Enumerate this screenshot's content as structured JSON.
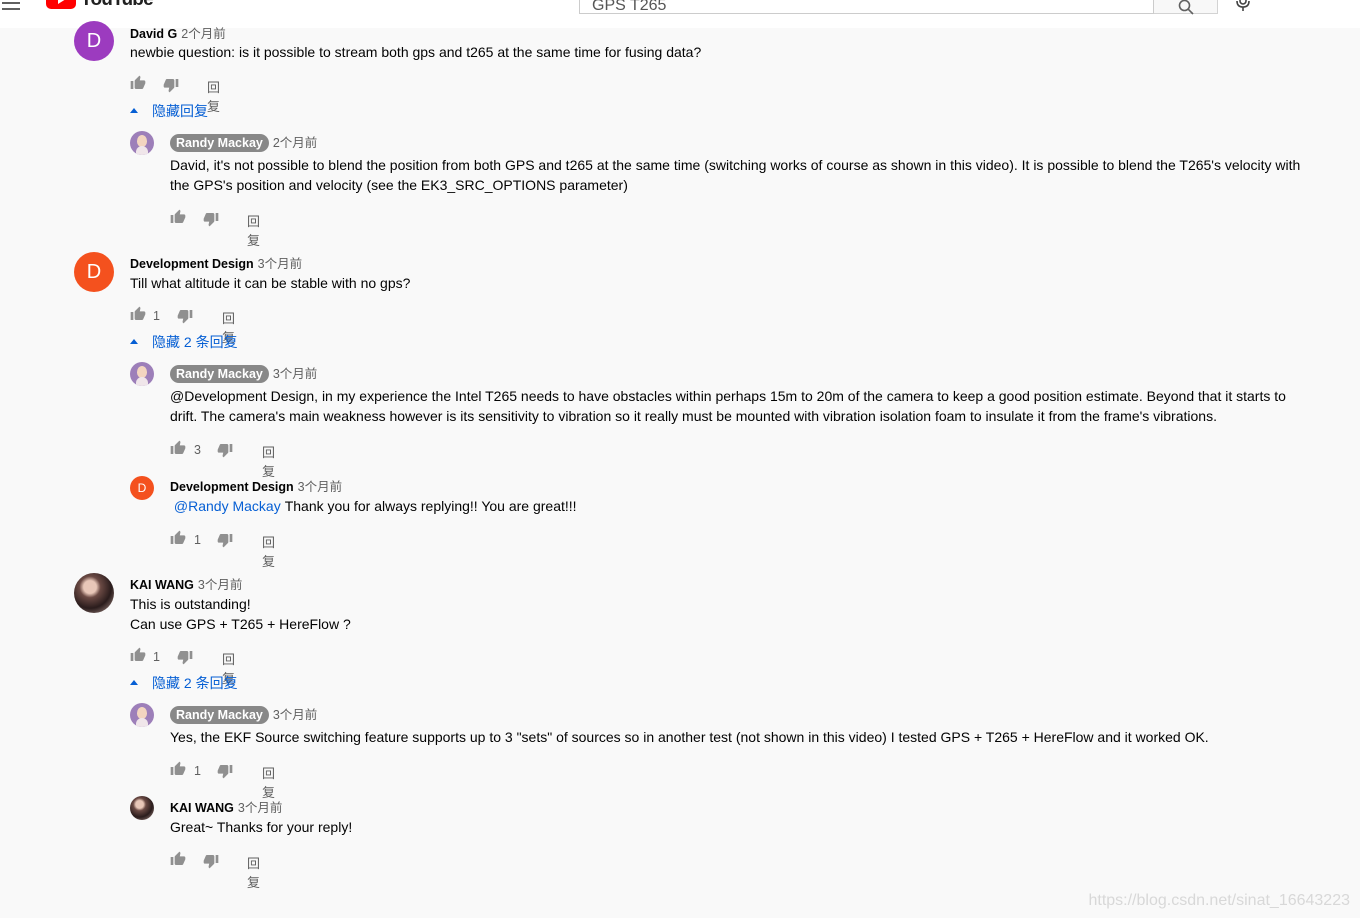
{
  "header": {
    "logo_text": "YouTube",
    "search_value": "GPS T265"
  },
  "threads": [
    {
      "author": "David G",
      "avatar_letter": "D",
      "time": "2个月前",
      "text": [
        "newbie question:  is it possible to stream both gps and t265 at the same time for fusing data?"
      ],
      "likes": "",
      "reply_label": "回复",
      "toggle_label": "隐藏回复",
      "replies": [
        {
          "author": "Randy Mackay",
          "time": "2个月前",
          "text": [
            "David, it's not possible to blend the position from both GPS and t265 at the same time (switching works of course as shown in this video).  It is possible to blend the T265's velocity with",
            "the GPS's position and velocity (see the EK3_SRC_OPTIONS parameter)"
          ],
          "likes": "",
          "reply_label": "回复"
        }
      ]
    },
    {
      "author": "Development Design",
      "avatar_letter": "D",
      "time": "3个月前",
      "text": [
        "Till what altitude it can be stable with no gps?"
      ],
      "likes": "1",
      "reply_label": "回复",
      "toggle_label": "隐藏 2 条回复",
      "replies": [
        {
          "author": "Randy Mackay",
          "time": "3个月前",
          "text": [
            "@Development Design, in my experience the Intel T265 needs to have obstacles within perhaps 15m to 20m of the camera to keep a good position estimate.  Beyond that it starts to",
            "drift.  The camera's main weakness however is its sensitivity to vibration so it really must be mounted with vibration isolation foam to insulate it from the frame's vibrations."
          ],
          "likes": "3",
          "reply_label": "回复"
        },
        {
          "author": "Development Design",
          "avatar_letter": "D",
          "time": "3个月前",
          "mention": "@Randy Mackay",
          "text": [
            "Thank you for always replying!! You are great!!!"
          ],
          "likes": "1",
          "reply_label": "回复"
        }
      ]
    },
    {
      "author": "KAI WANG",
      "time": "3个月前",
      "text": [
        "This  is outstanding!",
        "Can use GPS + T265 + HereFlow ?"
      ],
      "likes": "1",
      "reply_label": "回复",
      "toggle_label": "隐藏 2 条回复",
      "replies": [
        {
          "author": "Randy Mackay",
          "time": "3个月前",
          "text": [
            "Yes, the EKF Source switching feature supports up to 3 \"sets\" of sources so in another test (not shown in this video) I tested GPS + T265 + HereFlow and it worked OK."
          ],
          "likes": "1",
          "reply_label": "回复"
        },
        {
          "author": "KAI WANG",
          "time": "3个月前",
          "text": [
            "Great~ Thanks for your reply!"
          ],
          "likes": "",
          "reply_label": "回复"
        }
      ]
    }
  ],
  "watermark": "https://blog.csdn.net/sinat_16643223",
  "colors": {
    "link": "#065fd4",
    "owner_badge": "#888888",
    "avatar_purple": "#9c3bbf",
    "avatar_orange": "#f4511e"
  },
  "icons": [
    "menu-icon",
    "youtube-logo-icon",
    "search-icon",
    "mic-icon",
    "thumb-up-icon",
    "thumb-down-icon",
    "caret-up-icon"
  ]
}
